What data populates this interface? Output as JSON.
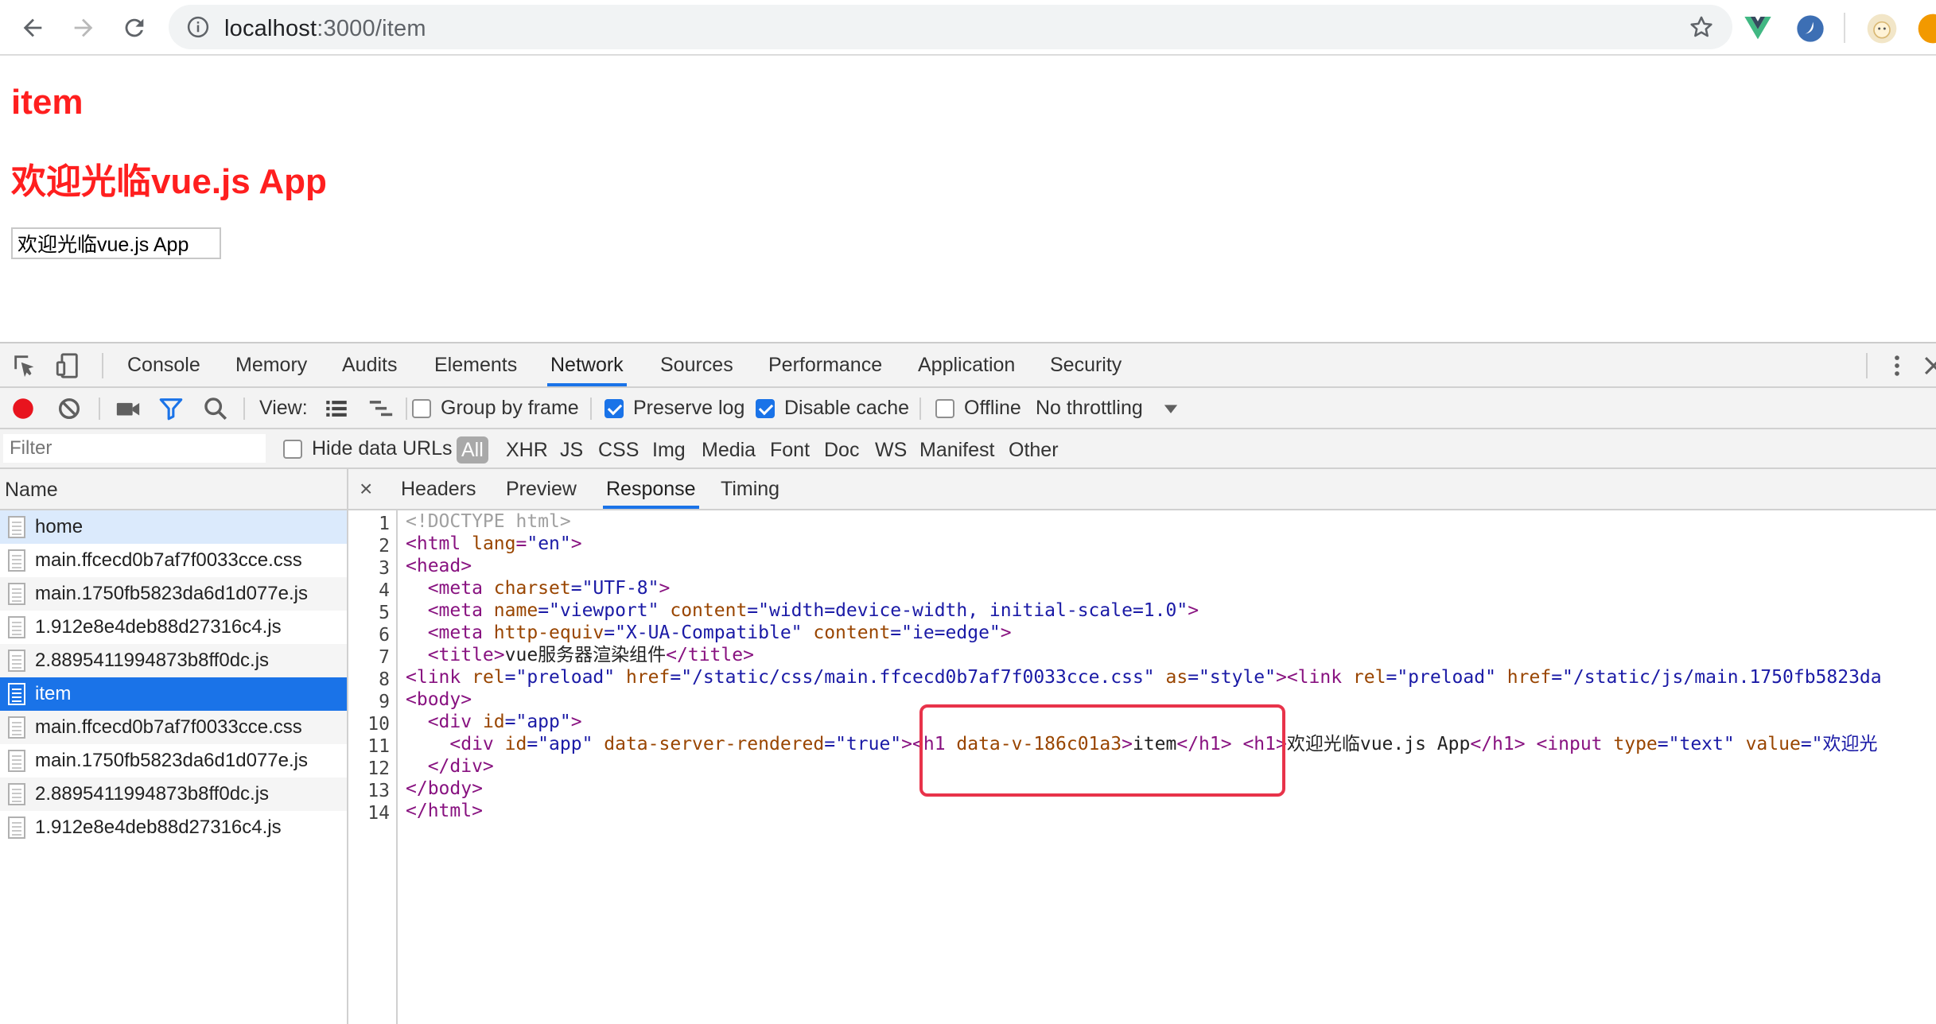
{
  "browser": {
    "url_host": "localhost",
    "url_path": ":3000/item"
  },
  "page": {
    "heading1": "item",
    "heading2": "欢迎光临vue.js App",
    "input_value": "欢迎光临vue.js App"
  },
  "devtools": {
    "main_tabs": [
      "Console",
      "Memory",
      "Audits",
      "Elements",
      "Network",
      "Sources",
      "Performance",
      "Application",
      "Security"
    ],
    "active_tab": "Network",
    "toolbar": {
      "view_label": "View:",
      "group_by_frame": "Group by frame",
      "preserve_log": "Preserve log",
      "disable_cache": "Disable cache",
      "offline": "Offline",
      "throttling": "No throttling"
    },
    "filter": {
      "placeholder": "Filter",
      "hide_data_urls": "Hide data URLs",
      "types": [
        "All",
        "XHR",
        "JS",
        "CSS",
        "Img",
        "Media",
        "Font",
        "Doc",
        "WS",
        "Manifest",
        "Other"
      ]
    },
    "name_header": "Name",
    "requests": [
      "home",
      "main.ffcecd0b7af7f0033cce.css",
      "main.1750fb5823da6d1d077e.js",
      "1.912e8e4deb88d27316c4.js",
      "2.8895411994873b8ff0dc.js",
      "item",
      "main.ffcecd0b7af7f0033cce.css",
      "main.1750fb5823da6d1d077e.js",
      "2.8895411994873b8ff0dc.js",
      "1.912e8e4deb88d27316c4.js"
    ],
    "detail_tabs": [
      "Headers",
      "Preview",
      "Response",
      "Timing"
    ],
    "active_detail_tab": "Response",
    "close_label": "×",
    "line_numbers": [
      "1",
      "2",
      "3",
      "4",
      "5",
      "6",
      "7",
      "8",
      "9",
      "10",
      "11",
      "12",
      "13",
      "14"
    ],
    "code": {
      "l1": "<!DOCTYPE html>",
      "l2_tag": "<html",
      "l2_attr": " lang",
      "l2_eq": "=",
      "l2_val": "\"en\"",
      "l2_end": ">",
      "l3": "<head>",
      "l4_tag": "  <meta",
      "l4_attr": " charset",
      "l4_val": "=\"UTF-8\"",
      "l4_end": ">",
      "l5_tag": "  <meta",
      "l5_attr1": " name",
      "l5_val1": "=\"viewport\"",
      "l5_attr2": " content",
      "l5_val2": "=\"width=device-width, initial-scale=1.0\"",
      "l5_end": ">",
      "l6_tag": "  <meta",
      "l6_attr1": " http-equiv",
      "l6_val1": "=\"X-UA-Compatible\"",
      "l6_attr2": " content",
      "l6_val2": "=\"ie=edge\"",
      "l6_end": ">",
      "l7_open": "  <title>",
      "l7_text": "vue服务器渲染组件",
      "l7_close": "</title>",
      "l8_tag": "<link",
      "l8_attr1": " rel",
      "l8_val1": "=\"preload\"",
      "l8_attr2": " href",
      "l8_val2": "=\"/static/css/main.ffcecd0b7af7f0033cce.css\"",
      "l8_attr3": " as",
      "l8_val3": "=\"style\"",
      "l8_tag2": "><link",
      "l8_attr4": " rel",
      "l8_val4": "=\"preload\"",
      "l8_attr5": " href",
      "l8_val5": "=\"/static/js/main.1750fb5823da",
      "l9": "<body>",
      "l10_tag": "  <div",
      "l10_attr": " id",
      "l10_val": "=\"app\"",
      "l10_end": ">",
      "l11_tag": "    <div",
      "l11_attr1": " id",
      "l11_val1": "=\"app\"",
      "l11_attr2": " data-server-rendered",
      "l11_val2": "=\"true\"",
      "l11_h1open": "><h1",
      "l11_h1attr": " data-v-186c01a3",
      "l11_h1end": ">",
      "l11_text1": "item",
      "l11_h1close": "</h1>",
      "l11_h1b": " <h1>",
      "l11_text2": "欢迎光临vue.js App",
      "l11_h1bclose": "</h1>",
      "l11_input": " <input",
      "l11_iattr1": " type",
      "l11_ival1": "=\"text\"",
      "l11_iattr2": " value",
      "l11_ival2": "=\"欢迎光",
      "l12": "  </div>",
      "l13": "</body>",
      "l14": "</html>"
    }
  },
  "colors": {
    "heading": "#ff1f1f",
    "accent": "#1a73e8",
    "record": "#e8141e",
    "highlight_box": "#e8334a"
  }
}
